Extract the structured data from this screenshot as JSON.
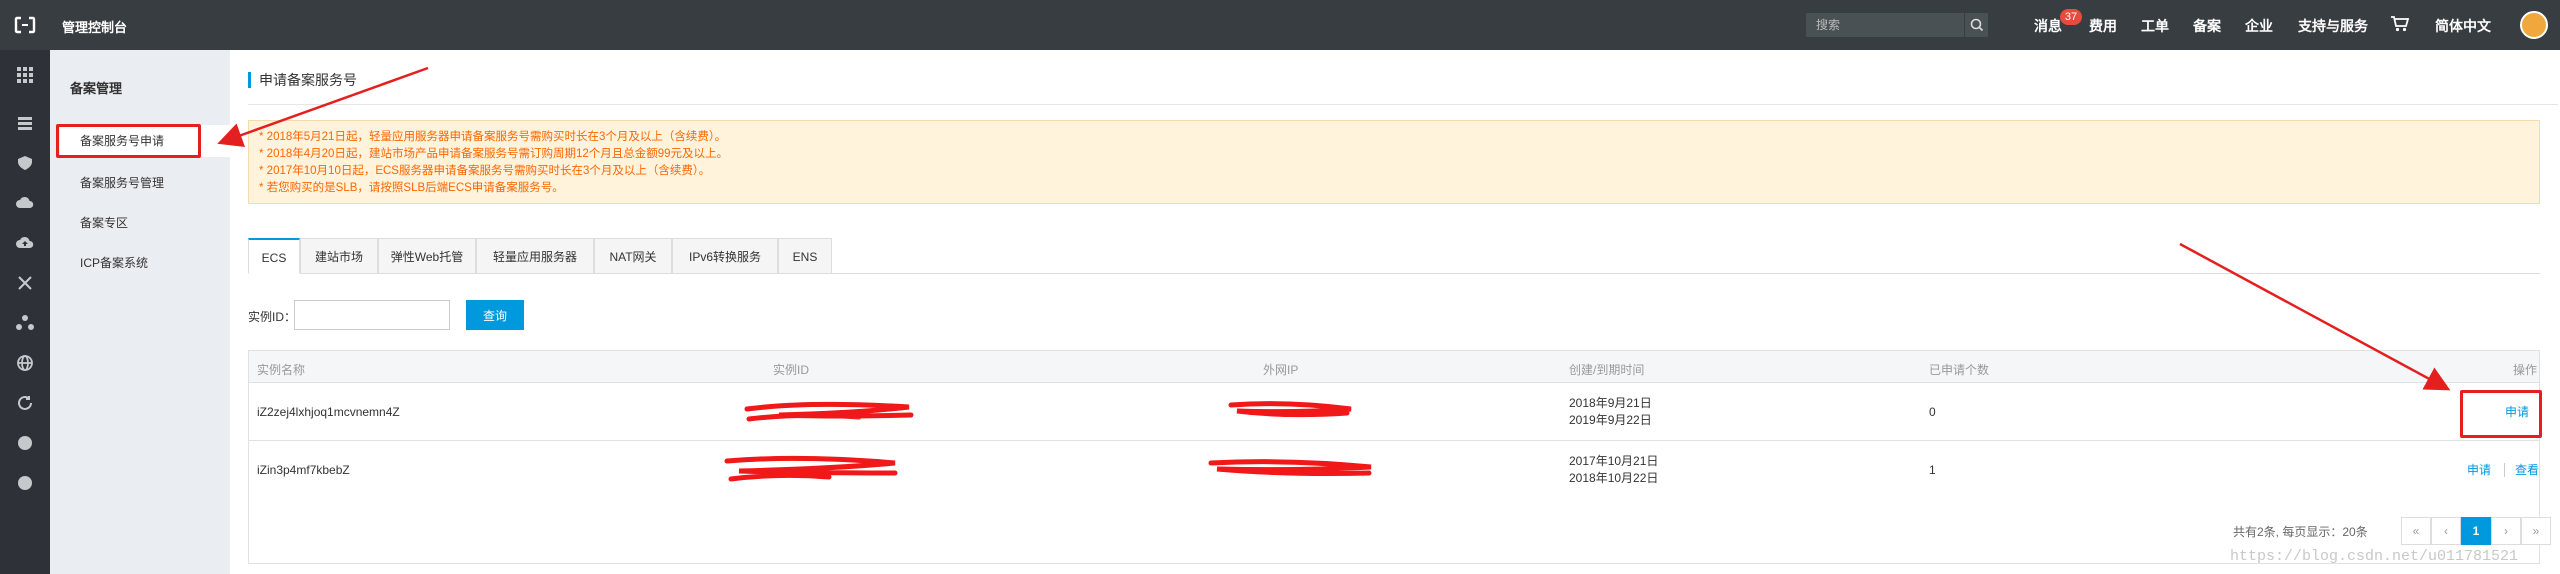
{
  "topbar": {
    "title": "管理控制台",
    "search_placeholder": "搜索",
    "nav": [
      "消息",
      "费用",
      "工单",
      "备案",
      "企业",
      "支持与服务",
      "简体中文"
    ],
    "message_count": "37",
    "icons": [
      "aliyun-logo-icon",
      "search-icon",
      "cart-icon",
      "avatar"
    ]
  },
  "icon_sidebar": {
    "icons": [
      "grid-icon",
      "list-icon",
      "shield-icon",
      "cloud-icon",
      "cloud-upload-icon",
      "network-icon",
      "cluster-icon",
      "globe-icon",
      "refresh-icon",
      "dot-icon",
      "dot-icon"
    ]
  },
  "sidebar": {
    "title": "备案管理",
    "items": [
      "备案服务号申请",
      "备案服务号管理",
      "备案专区",
      "ICP备案系统"
    ],
    "active_index": 0
  },
  "page": {
    "title": "申请备案服务号",
    "notices": [
      "* 2018年5月21日起，轻量应用服务器申请备案服务号需购买时长在3个月及以上（含续费）。",
      "* 2018年4月20日起，建站市场产品申请备案服务号需订购周期12个月且总金额99元及以上。",
      "* 2017年10月10日起，ECS服务器申请备案服务号需购买时长在3个月及以上（含续费）。",
      "* 若您购买的是SLB，请按照SLB后端ECS申请备案服务号。"
    ]
  },
  "tabs": [
    "ECS",
    "建站市场",
    "弹性Web托管",
    "轻量应用服务器",
    "NAT网关",
    "IPv6转换服务",
    "ENS"
  ],
  "active_tab": 0,
  "filter": {
    "label": "实例ID：",
    "value": "",
    "button": "查询"
  },
  "table": {
    "headers": [
      "实例名称",
      "实例ID",
      "外网IP",
      "创建/到期时间",
      "已申请个数",
      "操作"
    ],
    "rows": [
      {
        "name": "iZ2zej4lxhjoq1mcvnemn4Z",
        "created": "2018年9月21日",
        "expires": "2019年9月22日",
        "count": "0",
        "actions": [
          "申请"
        ]
      },
      {
        "name": "iZin3p4mf7kbebZ",
        "created": "2017年10月21日",
        "expires": "2018年10月22日",
        "count": "1",
        "actions": [
          "申请",
          "查看"
        ]
      }
    ]
  },
  "pagination": {
    "summary": "共有2条, 每页显示：20条",
    "buttons": [
      "«",
      "‹",
      "1",
      "›",
      "»"
    ],
    "current": "1"
  },
  "watermark": "https://blog.csdn.net/u011781521",
  "colors": {
    "topbar": "#373d41",
    "accent": "#0099dd",
    "notice_text": "#ff6600",
    "annotation": "#e41f1f"
  }
}
